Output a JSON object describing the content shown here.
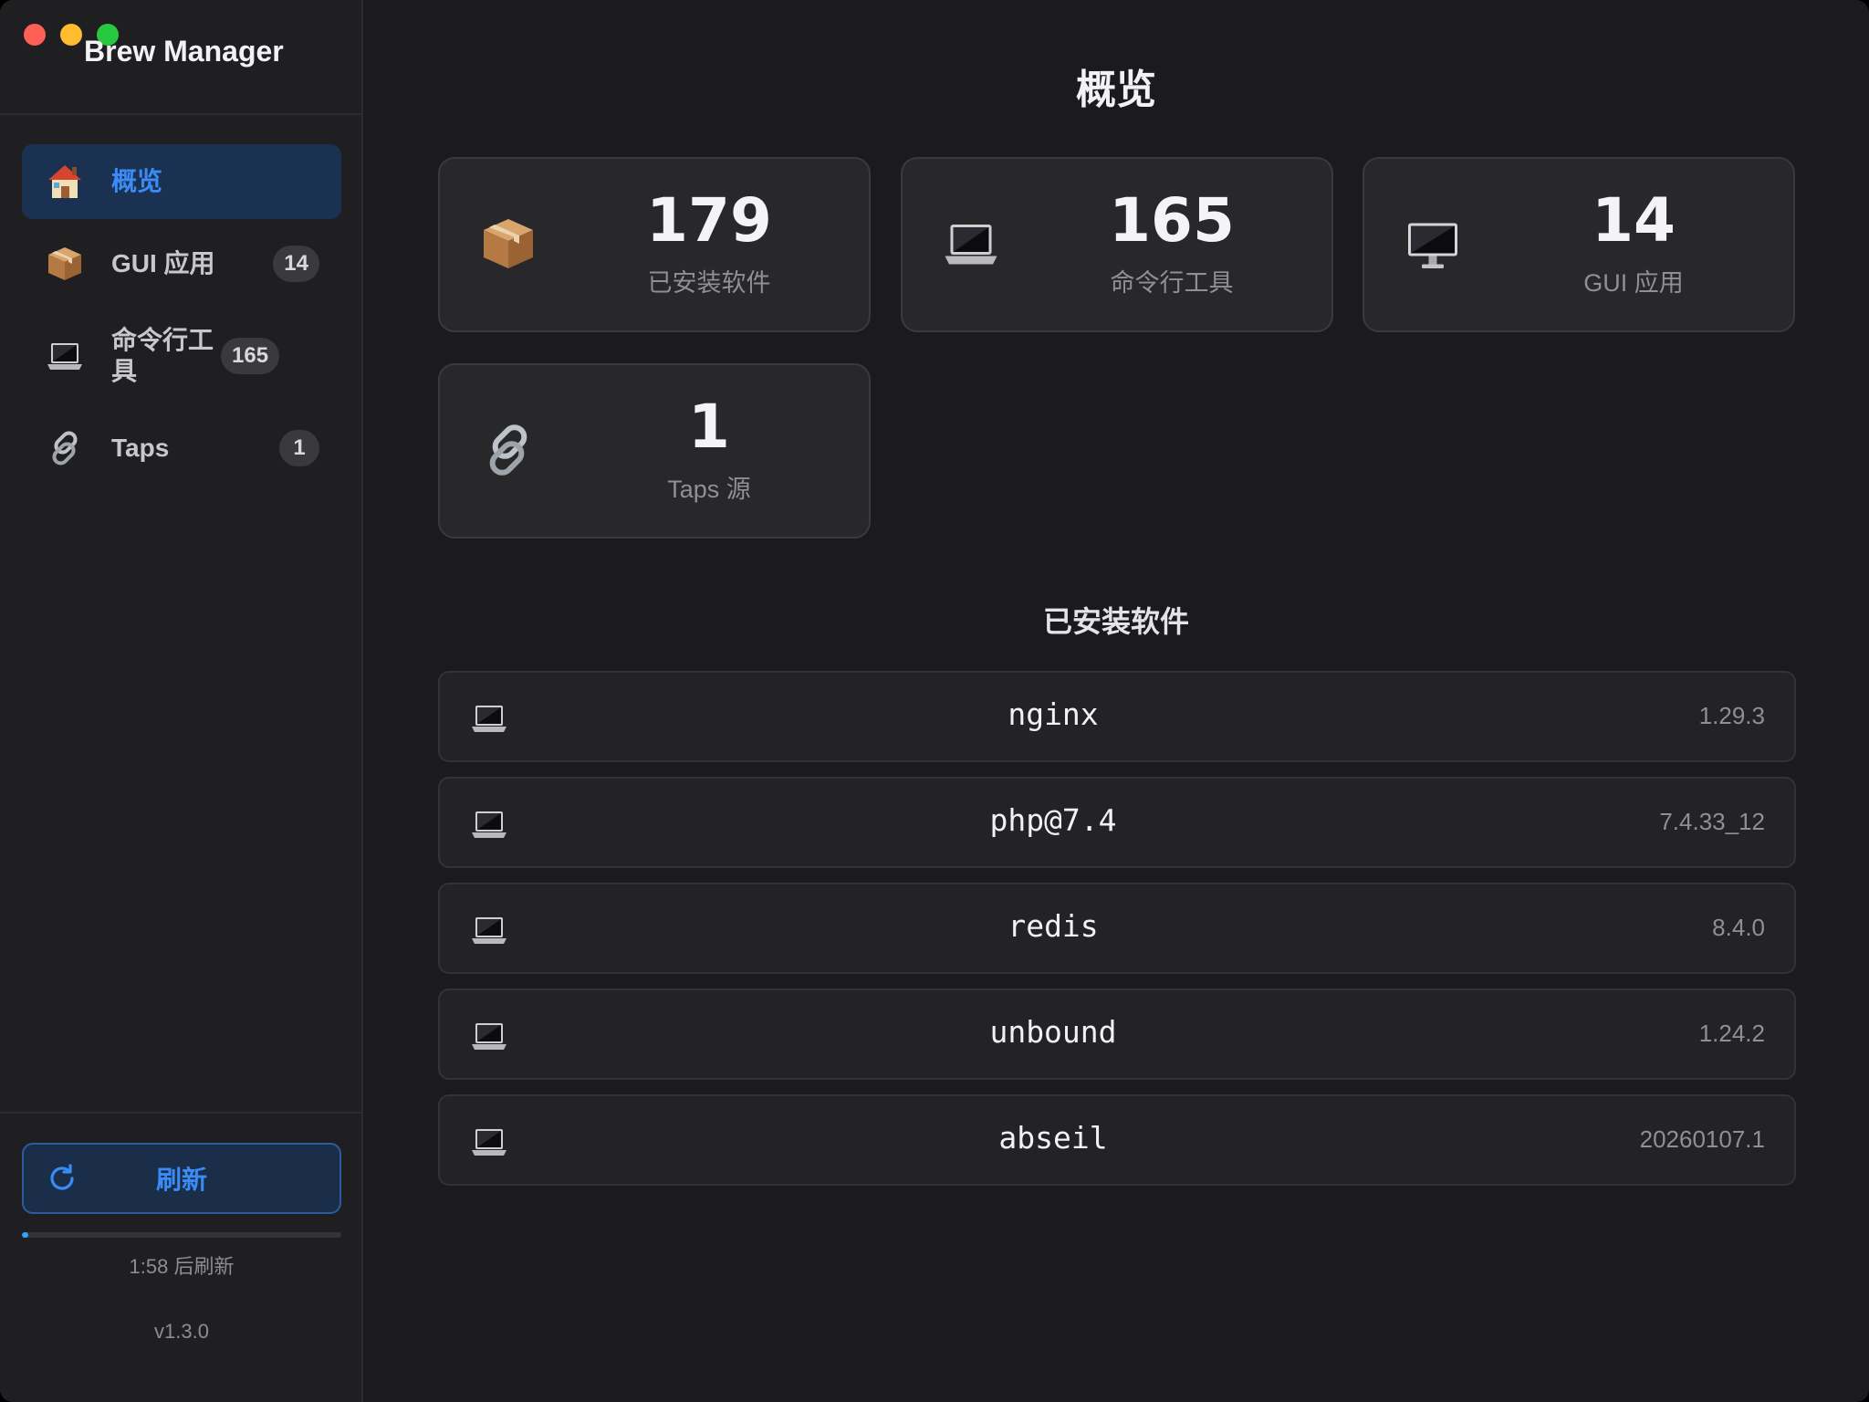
{
  "app": {
    "title": "Brew Manager"
  },
  "sidebar": {
    "items": [
      {
        "label": "概览",
        "icon": "house-icon",
        "badge": ""
      },
      {
        "label": "GUI 应用",
        "icon": "package-icon",
        "badge": "14"
      },
      {
        "label": "命令行工具",
        "icon": "laptop-icon",
        "badge": "165"
      },
      {
        "label": "Taps",
        "icon": "link-icon",
        "badge": "1"
      }
    ],
    "refresh_label": "刷新",
    "refresh_progress": 0.02,
    "countdown": "1:58 后刷新",
    "version": "v1.3.0"
  },
  "main": {
    "title": "概览",
    "stats": [
      {
        "value": "179",
        "label": "已安装软件",
        "icon": "package-icon"
      },
      {
        "value": "165",
        "label": "命令行工具",
        "icon": "laptop-icon"
      },
      {
        "value": "14",
        "label": "GUI 应用",
        "icon": "desktop-icon"
      },
      {
        "value": "1",
        "label": "Taps 源",
        "icon": "link-icon"
      }
    ],
    "section_title": "已安装软件",
    "packages": [
      {
        "name": "nginx",
        "version": "1.29.3"
      },
      {
        "name": "php@7.4",
        "version": "7.4.33_12"
      },
      {
        "name": "redis",
        "version": "8.4.0"
      },
      {
        "name": "unbound",
        "version": "1.24.2"
      },
      {
        "name": "abseil",
        "version": "20260107.1"
      }
    ]
  },
  "colors": {
    "accent": "#3b8bf6",
    "active_bg": "#1a3152",
    "background": "#1b1b1d",
    "sidebar_bg": "#1f1f21",
    "card_bg": "#28282b",
    "progress": "#2ea6ff"
  }
}
